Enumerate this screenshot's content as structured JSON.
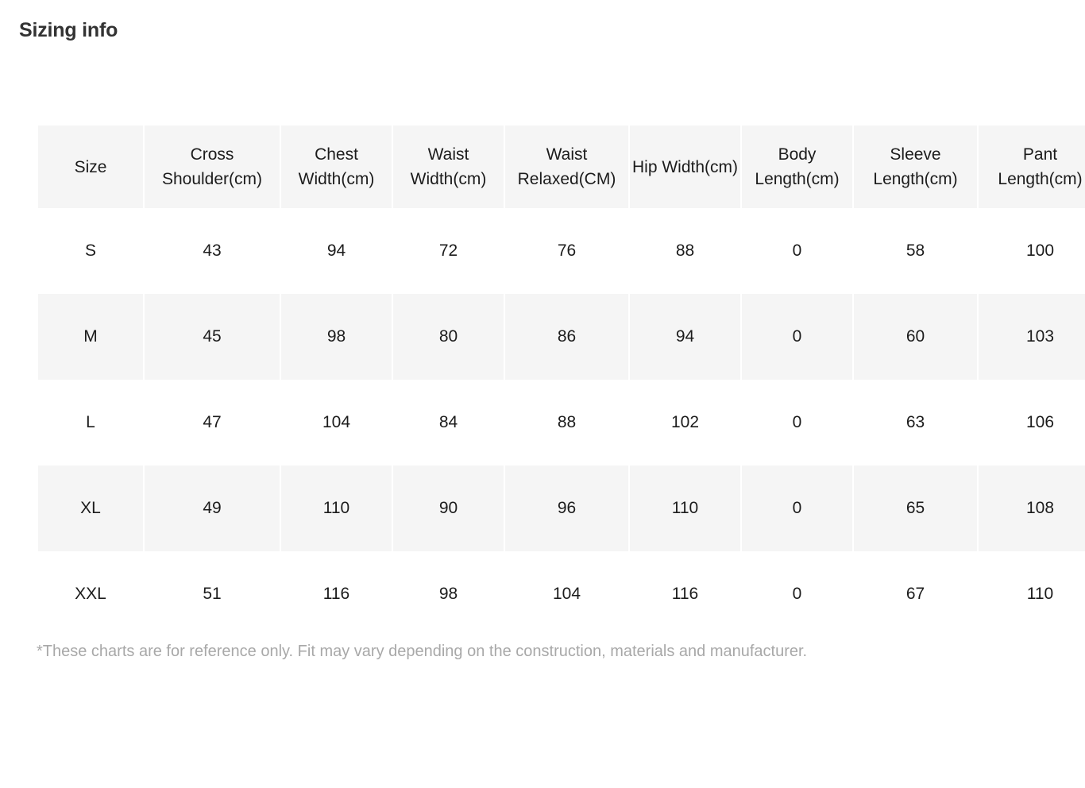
{
  "page": {
    "title": "Sizing info"
  },
  "table": {
    "columns": [
      "Size",
      "Cross Shoulder(cm)",
      "Chest Width(cm)",
      "Waist Width(cm)",
      "Waist Relaxed(CM)",
      "Hip Width(cm)",
      "Body Length(cm)",
      "Sleeve Length(cm)",
      "Pant Length(cm)"
    ],
    "rows": [
      {
        "size": "S",
        "cells": [
          "S",
          "43",
          "94",
          "72",
          "76",
          "88",
          "0",
          "58",
          "100"
        ]
      },
      {
        "size": "M",
        "cells": [
          "M",
          "45",
          "98",
          "80",
          "86",
          "94",
          "0",
          "60",
          "103"
        ]
      },
      {
        "size": "L",
        "cells": [
          "L",
          "47",
          "104",
          "84",
          "88",
          "102",
          "0",
          "63",
          "106"
        ]
      },
      {
        "size": "XL",
        "cells": [
          "XL",
          "49",
          "110",
          "90",
          "96",
          "110",
          "0",
          "65",
          "108"
        ]
      },
      {
        "size": "XXL",
        "cells": [
          "XXL",
          "51",
          "116",
          "98",
          "104",
          "116",
          "0",
          "67",
          "110"
        ]
      }
    ]
  },
  "footnote": {
    "text": "*These charts are for reference only. Fit may vary depending on the construction, materials and manufacturer."
  },
  "colors": {
    "cell_shade": "#f5f5f5",
    "title": "#333333",
    "text": "#1c1c1c",
    "footnote": "#a8a8a8",
    "background": "#ffffff"
  }
}
